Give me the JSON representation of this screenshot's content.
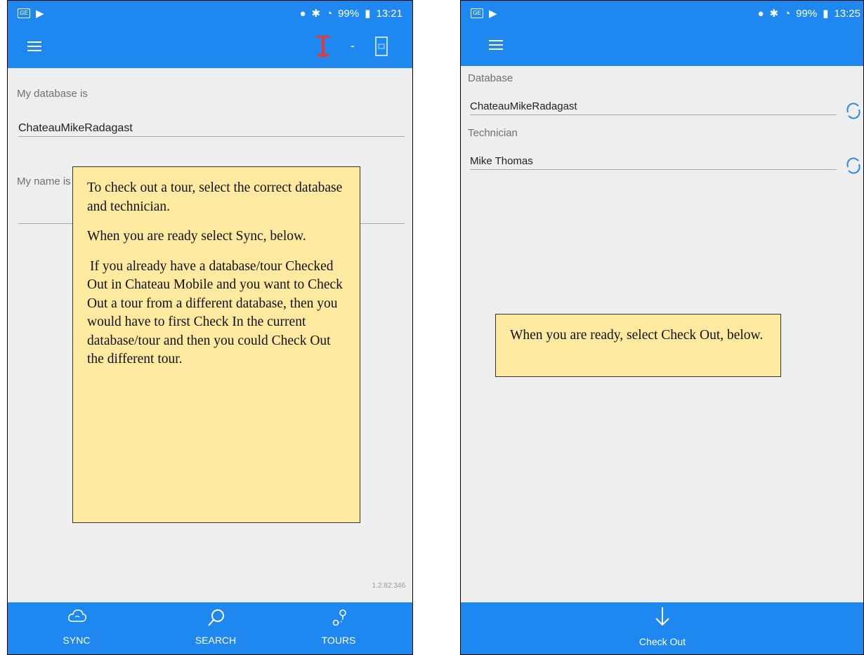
{
  "left": {
    "status": {
      "indicators": "99%",
      "time": "13:21",
      "icons": [
        "sim-icon",
        "play-store-icon",
        "location-icon",
        "bluetooth-icon",
        "wifi-icon",
        "battery-icon"
      ]
    },
    "toolbar": {
      "icons": [
        "menu-icon",
        "logo-icon",
        "minimize-icon",
        "window-icon"
      ],
      "dash": "-"
    },
    "database_label": "My database is",
    "database_value": "ChateauMikeRadagast",
    "name_label": "My name is",
    "note": {
      "p1": "To check out a tour, select the correct database and technician.",
      "p2": "When you are ready select Sync, below.",
      "p3": "If you already have a database/tour Checked Out in Chateau Mobile and you want to Check Out a tour from a different database, then you would have to first Check In the current database/tour and then you could Check Out the different tour."
    },
    "version": "1.2.82.346",
    "nav": [
      {
        "label": "SYNC",
        "icon": "cloud-sync-icon"
      },
      {
        "label": "SEARCH",
        "icon": "search-icon"
      },
      {
        "label": "TOURS",
        "icon": "map-pin-icon"
      }
    ]
  },
  "right": {
    "status": {
      "indicators": "99%",
      "time": "13:25"
    },
    "database_label": "Database",
    "database_value": "ChateauMikeRadagast",
    "technician_label": "Technician",
    "technician_value": "Mike Thomas",
    "note": "When you are ready, select Check Out, below.",
    "checkout_label": "Check Out"
  },
  "colors": {
    "primary": "#1e88f0",
    "note_bg": "#fde9a0",
    "background": "#eeeeee"
  }
}
